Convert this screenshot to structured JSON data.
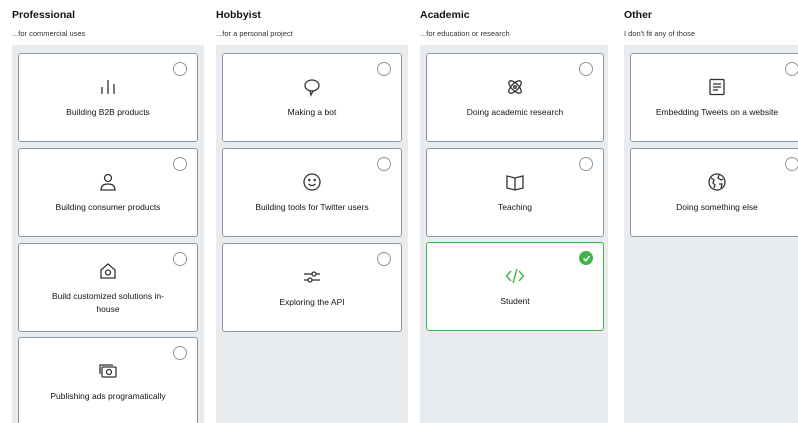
{
  "columns": [
    {
      "title": "Professional",
      "subtitle": "...for commercial uses",
      "cards": [
        {
          "label": "Building B2B products",
          "icon": "bar-chart-icon",
          "selected": false
        },
        {
          "label": "Building consumer products",
          "icon": "person-icon",
          "selected": false
        },
        {
          "label": "Build customized solutions in-house",
          "icon": "home-gear-icon",
          "selected": false
        },
        {
          "label": "Publishing ads programatically",
          "icon": "money-icon",
          "selected": false
        }
      ]
    },
    {
      "title": "Hobbyist",
      "subtitle": "...for a personal project",
      "cards": [
        {
          "label": "Making a bot",
          "icon": "speech-bubble-icon",
          "selected": false
        },
        {
          "label": "Building tools for Twitter users",
          "icon": "smiley-icon",
          "selected": false
        },
        {
          "label": "Exploring the API",
          "icon": "sliders-icon",
          "selected": false
        }
      ]
    },
    {
      "title": "Academic",
      "subtitle": "...for education or research",
      "cards": [
        {
          "label": "Doing academic research",
          "icon": "atom-icon",
          "selected": false
        },
        {
          "label": "Teaching",
          "icon": "book-icon",
          "selected": false
        },
        {
          "label": "Student",
          "icon": "code-icon",
          "selected": true
        }
      ]
    },
    {
      "title": "Other",
      "subtitle": "I don't fit any of those",
      "cards": [
        {
          "label": "Embedding Tweets on a website",
          "icon": "document-icon",
          "selected": false
        },
        {
          "label": "Doing something else",
          "icon": "globe-icon",
          "selected": false
        }
      ]
    }
  ],
  "colors": {
    "selected": "#3db54a",
    "panel": "#e9ecef",
    "border": "#8b98a5"
  }
}
